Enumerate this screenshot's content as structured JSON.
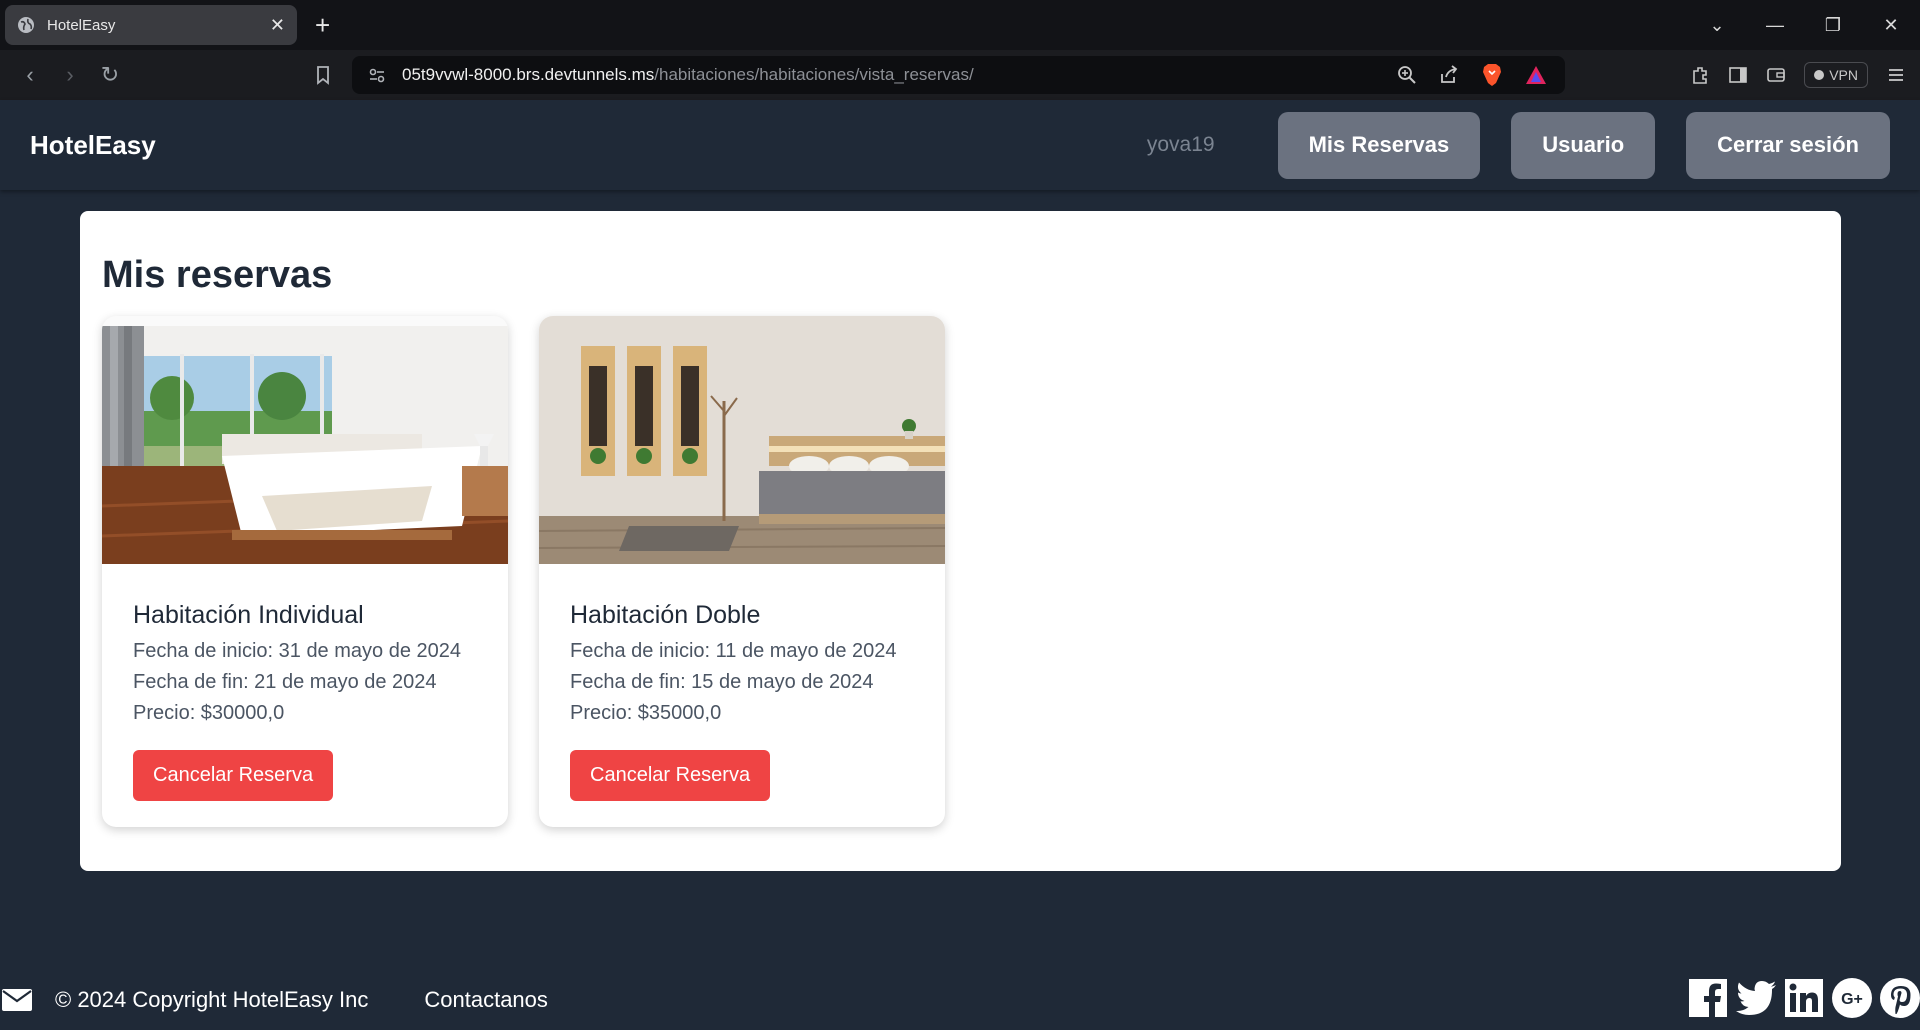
{
  "browser": {
    "tab_title": "HotelEasy",
    "url_host": "05t9vvwl-8000.brs.devtunnels.ms",
    "url_path": "/habitaciones/habitaciones/vista_reservas/",
    "vpn_label": "VPN"
  },
  "header": {
    "brand": "HotelEasy",
    "username": "yova19",
    "buttons": [
      {
        "label": "Mis Reservas"
      },
      {
        "label": "Usuario"
      },
      {
        "label": "Cerrar sesión"
      }
    ]
  },
  "main": {
    "title": "Mis reservas",
    "reservations": [
      {
        "room": "Habitación Individual",
        "start": "Fecha de inicio: 31 de mayo de 2024",
        "end": "Fecha de fin: 21 de mayo de 2024",
        "price": "Precio: $30000,0",
        "cancel_label": "Cancelar Reserva"
      },
      {
        "room": "Habitación Doble",
        "start": "Fecha de inicio: 11 de mayo de 2024",
        "end": "Fecha de fin: 15 de mayo de 2024",
        "price": "Precio: $35000,0",
        "cancel_label": "Cancelar Reserva"
      }
    ]
  },
  "footer": {
    "copyright": "© 2024 Copyright HotelEasy Inc",
    "contact": "Contactanos",
    "social_icons": [
      "facebook-icon",
      "twitter-icon",
      "linkedin-icon",
      "google-plus-icon",
      "pinterest-icon"
    ]
  },
  "colors": {
    "page_bg": "#1f2937",
    "header_button": "#6b7280",
    "cancel_button": "#ef4444"
  }
}
